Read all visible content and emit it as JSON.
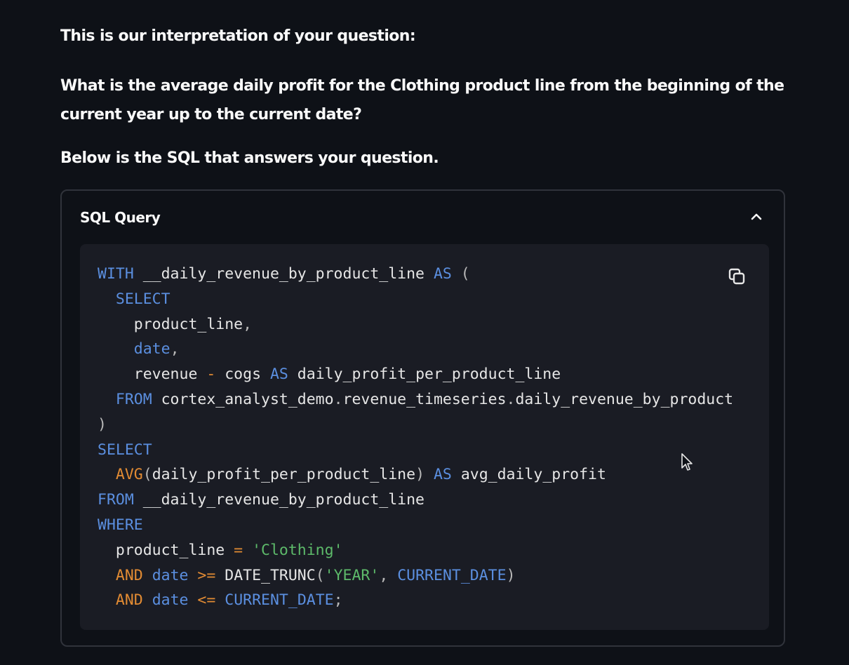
{
  "chat": {
    "intro": "This is our interpretation of your question:",
    "question": "What is the average daily profit for the Clothing product line from the beginning of the current year up to the current date?",
    "below": "Below is the SQL that answers your question."
  },
  "expander": {
    "title": "SQL Query",
    "state": "expanded",
    "chevron_icon": "chevron-up-icon",
    "copy_icon": "copy-icon"
  },
  "code": {
    "language": "sql",
    "lines": [
      [
        {
          "t": "kw",
          "s": "WITH"
        },
        {
          "t": "id",
          "s": " __daily_revenue_by_product_line "
        },
        {
          "t": "kw",
          "s": "AS"
        },
        {
          "t": "punct",
          "s": " ("
        }
      ],
      [
        {
          "t": "id",
          "s": "  "
        },
        {
          "t": "kw",
          "s": "SELECT"
        }
      ],
      [
        {
          "t": "id",
          "s": "    product_line"
        },
        {
          "t": "punct",
          "s": ","
        }
      ],
      [
        {
          "t": "id",
          "s": "    "
        },
        {
          "t": "kw",
          "s": "date"
        },
        {
          "t": "punct",
          "s": ","
        }
      ],
      [
        {
          "t": "id",
          "s": "    revenue "
        },
        {
          "t": "op",
          "s": "-"
        },
        {
          "t": "id",
          "s": " cogs "
        },
        {
          "t": "kw",
          "s": "AS"
        },
        {
          "t": "id",
          "s": " daily_profit_per_product_line"
        }
      ],
      [
        {
          "t": "id",
          "s": "  "
        },
        {
          "t": "kw",
          "s": "FROM"
        },
        {
          "t": "id",
          "s": " cortex_analyst_demo"
        },
        {
          "t": "punct",
          "s": "."
        },
        {
          "t": "id",
          "s": "revenue_timeseries"
        },
        {
          "t": "punct",
          "s": "."
        },
        {
          "t": "id",
          "s": "daily_revenue_by_product"
        }
      ],
      [
        {
          "t": "punct",
          "s": ")"
        }
      ],
      [
        {
          "t": "kw",
          "s": "SELECT"
        }
      ],
      [
        {
          "t": "id",
          "s": "  "
        },
        {
          "t": "op",
          "s": "AVG"
        },
        {
          "t": "punct",
          "s": "("
        },
        {
          "t": "id",
          "s": "daily_profit_per_product_line"
        },
        {
          "t": "punct",
          "s": ")"
        },
        {
          "t": "id",
          "s": " "
        },
        {
          "t": "kw",
          "s": "AS"
        },
        {
          "t": "id",
          "s": " avg_daily_profit"
        }
      ],
      [
        {
          "t": "kw",
          "s": "FROM"
        },
        {
          "t": "id",
          "s": " __daily_revenue_by_product_line"
        }
      ],
      [
        {
          "t": "kw",
          "s": "WHERE"
        }
      ],
      [
        {
          "t": "id",
          "s": "  product_line "
        },
        {
          "t": "op",
          "s": "="
        },
        {
          "t": "id",
          "s": " "
        },
        {
          "t": "str",
          "s": "'Clothing'"
        }
      ],
      [
        {
          "t": "id",
          "s": "  "
        },
        {
          "t": "op",
          "s": "AND"
        },
        {
          "t": "id",
          "s": " "
        },
        {
          "t": "kw",
          "s": "date"
        },
        {
          "t": "id",
          "s": " "
        },
        {
          "t": "op",
          "s": ">="
        },
        {
          "t": "id",
          "s": " DATE_TRUNC"
        },
        {
          "t": "punct",
          "s": "("
        },
        {
          "t": "str",
          "s": "'YEAR'"
        },
        {
          "t": "punct",
          "s": ", "
        },
        {
          "t": "kw",
          "s": "CURRENT_DATE"
        },
        {
          "t": "punct",
          "s": ")"
        }
      ],
      [
        {
          "t": "id",
          "s": "  "
        },
        {
          "t": "op",
          "s": "AND"
        },
        {
          "t": "id",
          "s": " "
        },
        {
          "t": "kw",
          "s": "date"
        },
        {
          "t": "id",
          "s": " "
        },
        {
          "t": "op",
          "s": "<="
        },
        {
          "t": "id",
          "s": " "
        },
        {
          "t": "kw",
          "s": "CURRENT_DATE"
        },
        {
          "t": "punct",
          "s": ";"
        }
      ]
    ]
  },
  "colors": {
    "background": "#0e1117",
    "code_background": "#1a1c24",
    "keyword": "#5b8fe0",
    "operator": "#e28b33",
    "string": "#5dba6a",
    "text": "#e6e6e6"
  }
}
